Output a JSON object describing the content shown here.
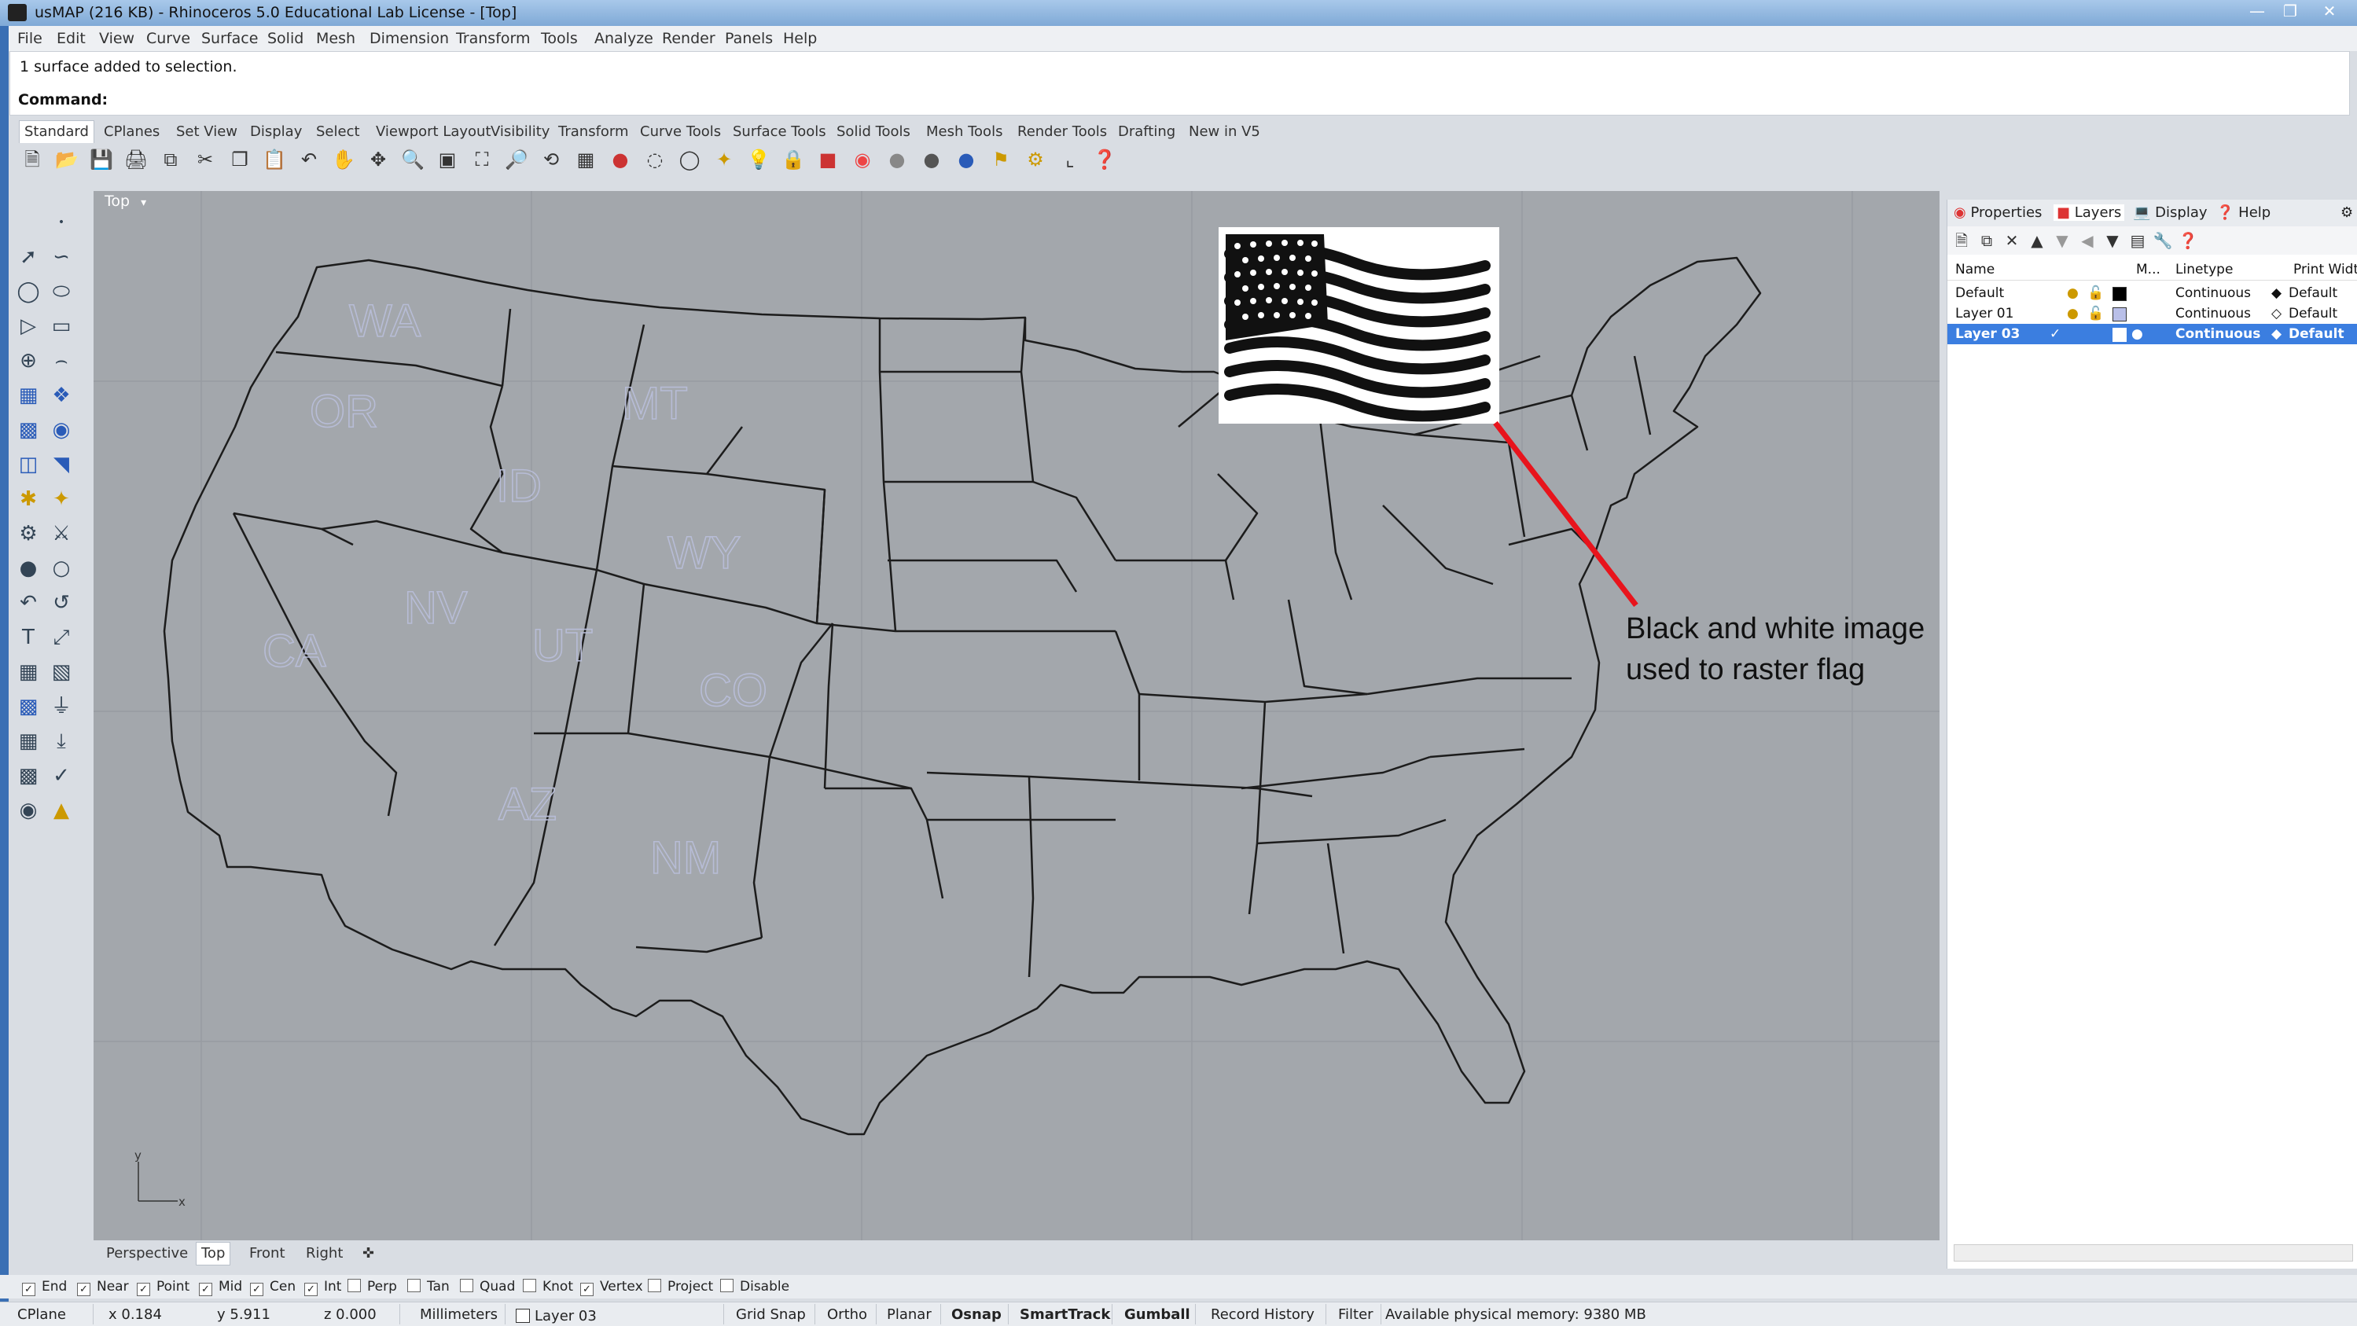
{
  "window": {
    "title": "usMAP (216 KB) - Rhinoceros 5.0 Educational Lab License - [Top]",
    "controls": [
      "minimize-icon",
      "restore-icon",
      "close-icon"
    ]
  },
  "menu": [
    "File",
    "Edit",
    "View",
    "Curve",
    "Surface",
    "Solid",
    "Mesh",
    "Dimension",
    "Transform",
    "Tools",
    "Analyze",
    "Render",
    "Panels",
    "Help"
  ],
  "command": {
    "history": "1 surface added to selection.",
    "prompt": "Command:"
  },
  "toolbar_tabs": [
    "Standard",
    "CPlanes",
    "Set View",
    "Display",
    "Select",
    "Viewport Layout",
    "Visibility",
    "Transform",
    "Curve Tools",
    "Surface Tools",
    "Solid Tools",
    "Mesh Tools",
    "Render Tools",
    "Drafting",
    "New in V5"
  ],
  "viewport": {
    "name": "Top",
    "tabs": [
      "Perspective",
      "Top",
      "Front",
      "Right"
    ],
    "active_tab": "Top",
    "state_labels": [
      "WA",
      "OR",
      "MT",
      "ID",
      "WY",
      "NV",
      "CA",
      "UT",
      "CO",
      "AZ",
      "NM"
    ],
    "axis_labels": {
      "x": "x",
      "y": "y"
    }
  },
  "annotation": {
    "line1": "Black and white image",
    "line2": "used to raster flag"
  },
  "panel": {
    "tabs": [
      "Properties",
      "Layers",
      "Display",
      "Help"
    ],
    "active_tab": "Layers",
    "columns": [
      "Name",
      "M...",
      "Linetype",
      "Print Width"
    ],
    "layers": [
      {
        "name": "Default",
        "linetype": "Continuous",
        "print_width": "Default",
        "color": "#000000",
        "current": false
      },
      {
        "name": "Layer 01",
        "linetype": "Continuous",
        "print_width": "Default",
        "color": "#b9bfe8",
        "current": false
      },
      {
        "name": "Layer 03",
        "linetype": "Continuous",
        "print_width": "Default",
        "color": "#ffffff",
        "current": true
      }
    ]
  },
  "osnaps": [
    {
      "label": "End",
      "checked": true
    },
    {
      "label": "Near",
      "checked": true
    },
    {
      "label": "Point",
      "checked": true
    },
    {
      "label": "Mid",
      "checked": true
    },
    {
      "label": "Cen",
      "checked": true
    },
    {
      "label": "Int",
      "checked": true
    },
    {
      "label": "Perp",
      "checked": false
    },
    {
      "label": "Tan",
      "checked": false
    },
    {
      "label": "Quad",
      "checked": false
    },
    {
      "label": "Knot",
      "checked": false
    },
    {
      "label": "Vertex",
      "checked": true
    },
    {
      "label": "Project",
      "checked": false
    },
    {
      "label": "Disable",
      "checked": false
    }
  ],
  "status": {
    "cplane": "CPlane",
    "x": "x 0.184",
    "y": "y 5.911",
    "z": "z 0.000",
    "units": "Millimeters",
    "layer": "Layer 03",
    "grid_snap": "Grid Snap",
    "ortho": "Ortho",
    "planar": "Planar",
    "osnap": "Osnap",
    "smarttrack": "SmartTrack",
    "gumball": "Gumball",
    "record_history": "Record History",
    "filter": "Filter",
    "memory": "Available physical memory: 9380 MB"
  },
  "colors": {
    "accent": "#3b7ee0",
    "annotation_line": "#e8141c",
    "viewport_bg": "#a3a7ac",
    "state_label": "#b7bcd6"
  }
}
